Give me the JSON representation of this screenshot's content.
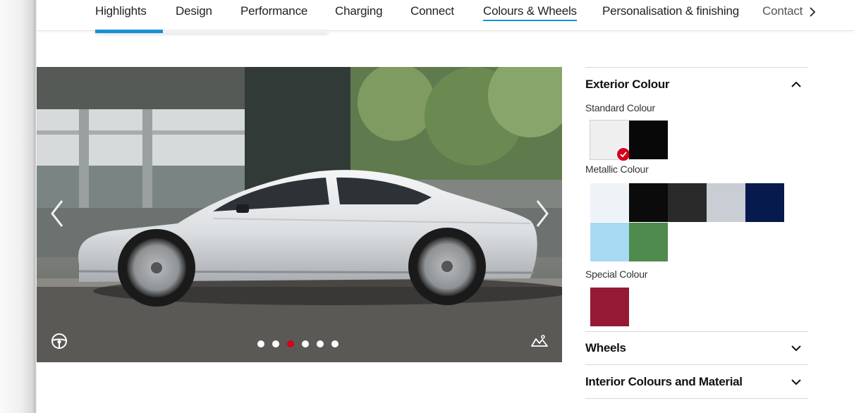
{
  "nav": {
    "items": [
      "Highlights",
      "Design",
      "Performance",
      "Charging",
      "Connect",
      "Colours & Wheels",
      "Personalisation & finishing",
      "Contact"
    ],
    "active_index": 5,
    "next_icon": "chevron-right-icon",
    "progress": 0.29
  },
  "gallery": {
    "prev_icon": "chevron-left-icon",
    "next_icon": "chevron-right-icon",
    "slide_count": 6,
    "active_slide": 3,
    "view_360_icon": "steering-wheel-icon",
    "background_icon": "scenery-icon",
    "active_dot_color": "#d5001c"
  },
  "config": {
    "exterior": {
      "title": "Exterior Colour",
      "toggle_icon": "chevron-up-icon",
      "groups": [
        {
          "label": "Standard Colour",
          "swatches": [
            {
              "color": "#efefef",
              "selected": true
            },
            {
              "color": "#080808",
              "selected": false
            }
          ]
        },
        {
          "label": "Metallic Colour",
          "swatches": [
            {
              "color": "#eef3f8",
              "selected": false
            },
            {
              "color": "#0b0b0b",
              "selected": false
            },
            {
              "color": "#2a2a2a",
              "selected": false
            },
            {
              "color": "#c9ced4",
              "selected": false
            },
            {
              "color": "#061a4e",
              "selected": false
            },
            {
              "color": "#a8d9f3",
              "selected": false
            },
            {
              "color": "#4f8a4e",
              "selected": false
            }
          ]
        },
        {
          "label": "Special Colour",
          "swatches": [
            {
              "color": "#951935",
              "selected": false
            }
          ]
        }
      ]
    },
    "wheels": {
      "title": "Wheels",
      "toggle_icon": "chevron-down-icon"
    },
    "interior": {
      "title": "Interior Colours and Material",
      "toggle_icon": "chevron-down-icon"
    }
  },
  "colors": {
    "accent_blue": "#1b8fd6",
    "accent_red": "#d5001c"
  }
}
